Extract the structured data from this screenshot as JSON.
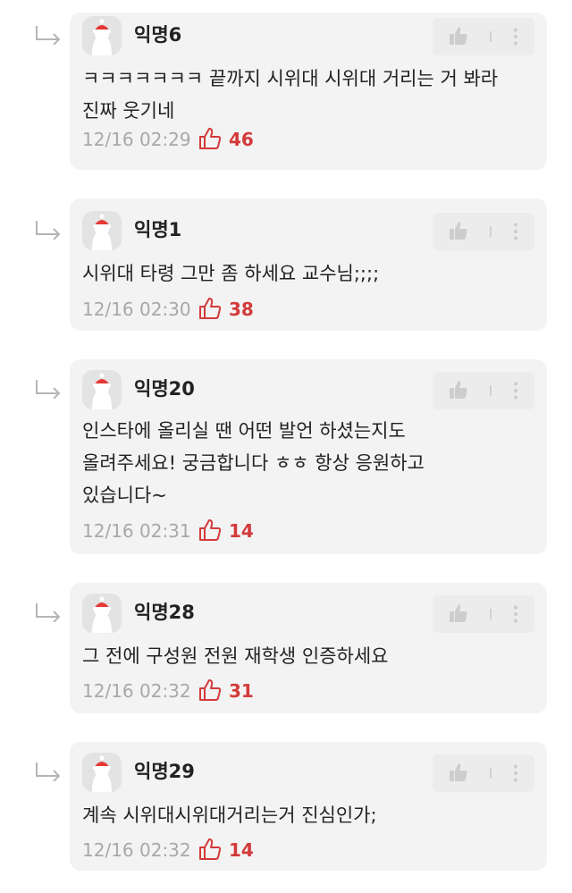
{
  "theme": {
    "like_color": "#d33a3a",
    "card_background": "#f3f3f3",
    "time_color": "#a8a8a8"
  },
  "icons": {
    "reply": "reply-arrow-icon",
    "avatar": "santa-hat-avatar-icon",
    "like_button": "thumbs-up-icon",
    "more_button": "vertical-ellipsis-icon",
    "like_count": "thumbs-up-outline-icon"
  },
  "comments": [
    {
      "nickname": "익명6",
      "text": "ㅋㅋㅋㅋㅋㅋㅋ 끝까지 시위대 시위대 거리는 거 봐라\n진짜 웃기네",
      "time": "12/16 02:29",
      "likes": "46"
    },
    {
      "nickname": "익명1",
      "text": "시위대 타령 그만 좀 하세요 교수님;;;;",
      "time": "12/16 02:30",
      "likes": "38"
    },
    {
      "nickname": "익명20",
      "text": "인스타에 올리실 땐 어떤 발언 하셨는지도\n올려주세요! 궁금합니다 ㅎㅎ 항상 응원하고\n있습니다~",
      "time": "12/16 02:31",
      "likes": "14"
    },
    {
      "nickname": "익명28",
      "text": "그 전에 구성원 전원 재학생 인증하세요",
      "time": "12/16 02:32",
      "likes": "31"
    },
    {
      "nickname": "익명29",
      "text": "계속 시위대시위대거리는거 진심인가;",
      "time": "12/16 02:32",
      "likes": "14"
    }
  ]
}
